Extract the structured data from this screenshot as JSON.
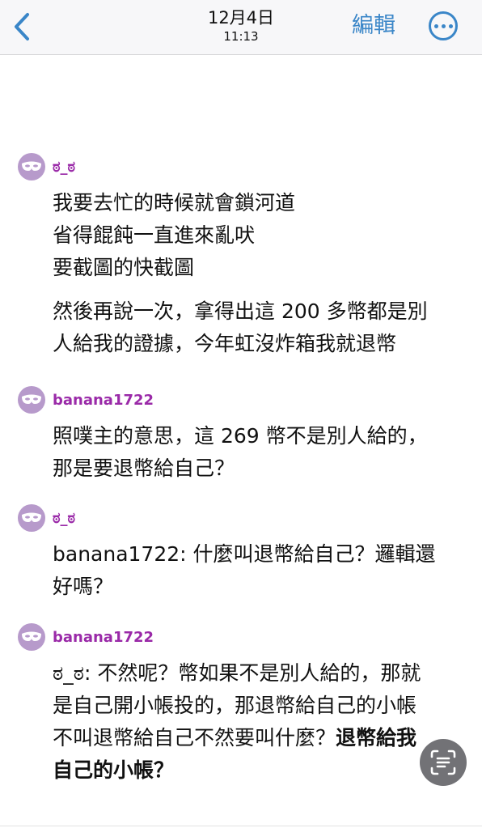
{
  "nav": {
    "back_icon": "chevron-left-icon",
    "date": "12月4日",
    "time": "11:13",
    "edit_label": "編輯",
    "more_icon": "ellipsis-circle-icon",
    "accent": "#3a86c8"
  },
  "messages": [
    {
      "user": "ಠ_ಠ",
      "avatar_icon": "mask-icon",
      "lines": [
        "我要去忙的時候就會鎖河道",
        "省得餛飩一直進來亂吠",
        "要截圖的快截圖"
      ],
      "lines2": [
        "然後再說一次，拿得出這 200 多幣都是別",
        "人給我的證據，今年虹沒炸箱我就退幣"
      ]
    },
    {
      "user": "banana1722",
      "avatar_icon": "mask-icon",
      "lines": [
        "照噗主的意思，這 269 幣不是別人給的，",
        "那是要退幣給自己？"
      ]
    },
    {
      "user": "ಠ_ಠ",
      "avatar_icon": "mask-icon",
      "lines": [
        "banana1722: 什麼叫退幣給自己？邏輯還",
        "好嗎？"
      ]
    },
    {
      "user": "banana1722",
      "avatar_icon": "mask-icon",
      "lines": [
        "ಠ_ಠ: 不然呢？幣如果不是別人給的，那就",
        "是自己開小帳投的，那退幣給自己的小帳"
      ],
      "line3_normal": "不叫退幣給自己不然要叫什麼？",
      "line3_bold": "退幣給我",
      "line4_bold": "自己的小帳？"
    }
  ],
  "scan_icon": "text-scan-icon",
  "colors": {
    "username": "#9a2aa8",
    "avatar_bg": "#b79acb"
  }
}
